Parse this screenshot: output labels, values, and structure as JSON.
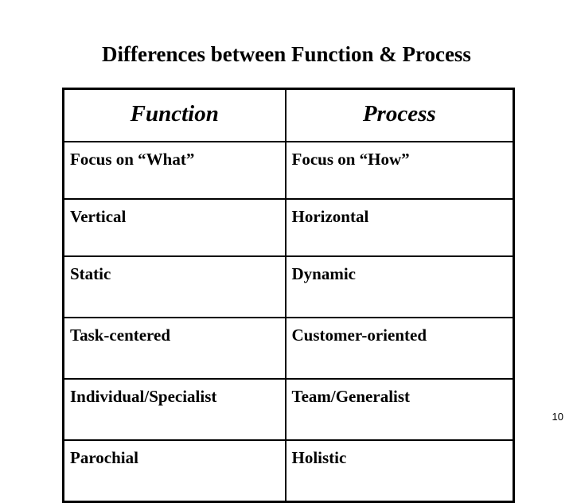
{
  "slide": {
    "title": "Differences between Function & Process",
    "page_number": "10"
  },
  "table": {
    "headers": [
      {
        "label": "Function"
      },
      {
        "label": "Process"
      }
    ],
    "rows": [
      {
        "function": "Focus on “What”",
        "process": "Focus on “How”"
      },
      {
        "function": "Vertical",
        "process": "Horizontal"
      },
      {
        "function": "Static",
        "process": "Dynamic"
      },
      {
        "function": "Task-centered",
        "process": "Customer-oriented"
      },
      {
        "function": "Individual/Specialist",
        "process": "Team/Generalist"
      },
      {
        "function": "Parochial",
        "process": "Holistic"
      }
    ]
  }
}
